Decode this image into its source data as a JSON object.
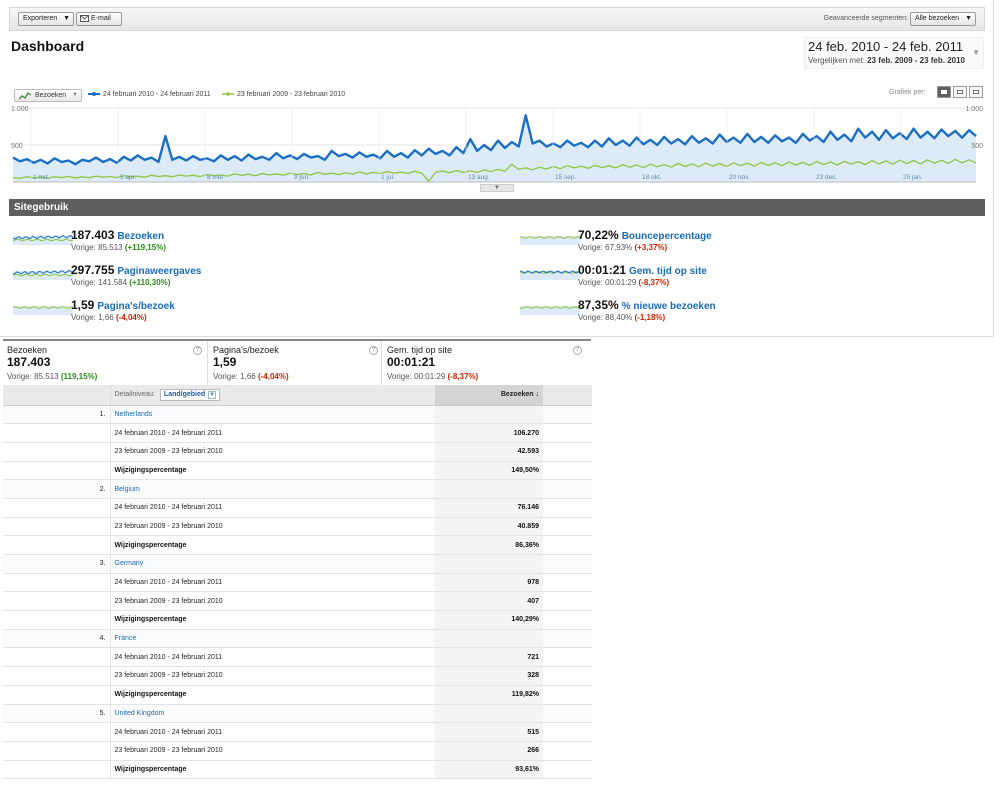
{
  "toolbar": {
    "export_label": "Exporteren",
    "email_label": "E-mail",
    "segments_label": "Geavanceerde segmenten:",
    "segments_value": "Alle bezoeken"
  },
  "page_title": "Dashboard",
  "date_range": {
    "main": "24 feb. 2010 - 24 feb. 2011",
    "compare_prefix": "Vergelijken met:",
    "compare_range": "23 feb. 2009 - 23 feb. 2010"
  },
  "chart_controls": {
    "metric_button": "Bezoeken",
    "graph_by_label": "Grafiek per:"
  },
  "colors": {
    "primary_series": "#1a6fc4",
    "secondary_series": "#8cc63f",
    "area_fill": "#dcebf7",
    "positive": "#2a8a19",
    "negative": "#cc2200",
    "link": "#1a6bb8"
  },
  "chart_data": {
    "type": "line",
    "ylim": [
      0,
      1000
    ],
    "y_ticks": [
      "1.000",
      "500"
    ],
    "y_ticks_right": [
      "1.000",
      "500"
    ],
    "x_ticks": [
      "1 mrt.",
      "5 apr.",
      "8 mei",
      "9 jun.",
      "1 jul.",
      "13 aug.",
      "15 sep.",
      "18 okt.",
      "20 nov.",
      "23 dec.",
      "25 jan."
    ],
    "series": [
      {
        "name": "24 februari 2010 - 24 februari 2011",
        "values": [
          330,
          280,
          310,
          260,
          300,
          250,
          320,
          270,
          290,
          240,
          300,
          280,
          330,
          270,
          310,
          260,
          340,
          290,
          360,
          300,
          330,
          270,
          620,
          300,
          340,
          290,
          350,
          300,
          320,
          280,
          360,
          300,
          350,
          290,
          370,
          310,
          340,
          300,
          390,
          320,
          360,
          310,
          380,
          330,
          350,
          300,
          420,
          350,
          380,
          330,
          400,
          340,
          370,
          320,
          420,
          340,
          390,
          330,
          430,
          360,
          450,
          380,
          420,
          360,
          470,
          390,
          580,
          420,
          500,
          430,
          560,
          460,
          540,
          480,
          900,
          520,
          560,
          480,
          520,
          470,
          560,
          490,
          530,
          470,
          560,
          480,
          590,
          500,
          560,
          490,
          600,
          510,
          570,
          500,
          610,
          520,
          580,
          510,
          620,
          530,
          590,
          520,
          640,
          540,
          600,
          530,
          650,
          540,
          610,
          530,
          630,
          550,
          600,
          530,
          650,
          560,
          620,
          540,
          680,
          570,
          640,
          550,
          720,
          600,
          680,
          570,
          700,
          590,
          660,
          580,
          720,
          600,
          680,
          590,
          710,
          620,
          690,
          600,
          700,
          620
        ]
      },
      {
        "name": "23 februari 2009 - 23 februari 2010",
        "values": [
          60,
          50,
          70,
          55,
          65,
          50,
          70,
          60,
          75,
          55,
          70,
          60,
          80,
          65,
          75,
          60,
          85,
          70,
          80,
          65,
          90,
          75,
          85,
          70,
          95,
          80,
          90,
          75,
          100,
          85,
          95,
          80,
          110,
          90,
          105,
          85,
          115,
          95,
          110,
          90,
          120,
          100,
          115,
          95,
          130,
          105,
          120,
          100,
          125,
          105,
          135,
          110,
          130,
          115,
          140,
          120,
          135,
          115,
          145,
          120,
          10,
          130,
          150,
          125,
          155,
          130,
          150,
          130,
          165,
          140,
          170,
          145,
          240,
          170,
          190,
          165,
          200,
          175,
          210,
          180,
          220,
          190,
          215,
          185,
          225,
          195,
          220,
          190,
          235,
          200,
          230,
          195,
          240,
          205,
          235,
          200,
          250,
          210,
          245,
          205,
          255,
          215,
          250,
          210,
          260,
          220,
          255,
          215,
          265,
          225,
          260,
          220,
          270,
          230,
          265,
          225,
          275,
          235,
          270,
          230,
          280,
          240,
          275,
          235,
          290,
          245,
          285,
          240,
          295,
          250,
          290,
          245,
          300,
          255,
          295,
          250,
          305,
          260,
          300,
          255
        ]
      }
    ]
  },
  "site_usage": {
    "title": "Sitegebruik",
    "prev_prefix": "Vorige:",
    "metrics": [
      {
        "value": "187.403",
        "label": "Bezoeken",
        "prev": "85.513",
        "delta": "(+119,15%)",
        "delta_type": "pos"
      },
      {
        "value": "297.755",
        "label": "Paginaweergaves",
        "prev": "141.584",
        "delta": "(+110,30%)",
        "delta_type": "pos"
      },
      {
        "value": "1,59",
        "label": "Pagina's/bezoek",
        "prev": "1,66",
        "delta": "(-4,04%)",
        "delta_type": "neg"
      },
      {
        "value": "70,22%",
        "label": "Bouncepercentage",
        "prev": "67,93%",
        "delta": "(+3,37%)",
        "delta_type": "neg"
      },
      {
        "value": "00:01:21",
        "label": "Gem. tijd op site",
        "prev": "00:01:29",
        "delta": "(-8,37%)",
        "delta_type": "neg"
      },
      {
        "value": "87,35%",
        "label": "% nieuwe bezoeken",
        "prev": "88,40%",
        "delta": "(-1,18%)",
        "delta_type": "neg"
      }
    ]
  },
  "summary": {
    "visits": {
      "label": "Bezoeken",
      "value": "187.403",
      "prev_prefix": "Vorige:",
      "prev": "85.513",
      "delta": "(119,15%)"
    },
    "pages": {
      "label": "Pagina's/bezoek",
      "value": "1,59",
      "prev_prefix": "Vorige:",
      "prev": "1,66",
      "delta": "(-4,04%)"
    },
    "time": {
      "label": "Gem. tijd op site",
      "value": "00:01:21",
      "prev_prefix": "Vorige:",
      "prev": "00:01:29",
      "delta": "(-8,37%)"
    }
  },
  "table": {
    "dimension_label": "Detailniveau:",
    "dimension_value": "Land/gebied",
    "sort_column": "Bezoeken",
    "rows": [
      {
        "type": "country",
        "idx": "1.",
        "name": "Netherlands",
        "value": ""
      },
      {
        "type": "range",
        "idx": "",
        "name": "24 februari 2010 - 24 februari 2011",
        "value": "106.270"
      },
      {
        "type": "range",
        "idx": "",
        "name": "23 februari 2009 - 23 februari 2010",
        "value": "42.593"
      },
      {
        "type": "pct",
        "idx": "",
        "name": "Wijzigingspercentage",
        "value": "149,50%"
      },
      {
        "type": "country",
        "idx": "2.",
        "name": "Belgium",
        "value": ""
      },
      {
        "type": "range",
        "idx": "",
        "name": "24 februari 2010 - 24 februari 2011",
        "value": "76.146"
      },
      {
        "type": "range",
        "idx": "",
        "name": "23 februari 2009 - 23 februari 2010",
        "value": "40.859"
      },
      {
        "type": "pct",
        "idx": "",
        "name": "Wijzigingspercentage",
        "value": "86,36%"
      },
      {
        "type": "country",
        "idx": "3.",
        "name": "Germany",
        "value": ""
      },
      {
        "type": "range",
        "idx": "",
        "name": "24 februari 2010 - 24 februari 2011",
        "value": "978"
      },
      {
        "type": "range",
        "idx": "",
        "name": "23 februari 2009 - 23 februari 2010",
        "value": "407"
      },
      {
        "type": "pct",
        "idx": "",
        "name": "Wijzigingspercentage",
        "value": "140,29%"
      },
      {
        "type": "country",
        "idx": "4.",
        "name": "France",
        "value": ""
      },
      {
        "type": "range",
        "idx": "",
        "name": "24 februari 2010 - 24 februari 2011",
        "value": "721"
      },
      {
        "type": "range",
        "idx": "",
        "name": "23 februari 2009 - 23 februari 2010",
        "value": "328"
      },
      {
        "type": "pct",
        "idx": "",
        "name": "Wijzigingspercentage",
        "value": "119,82%"
      },
      {
        "type": "country",
        "idx": "5.",
        "name": "United Kingdom",
        "value": ""
      },
      {
        "type": "range",
        "idx": "",
        "name": "24 februari 2010 - 24 februari 2011",
        "value": "515"
      },
      {
        "type": "range",
        "idx": "",
        "name": "23 februari 2009 - 23 februari 2010",
        "value": "266"
      },
      {
        "type": "pct",
        "idx": "",
        "name": "Wijzigingspercentage",
        "value": "93,61%"
      }
    ]
  }
}
